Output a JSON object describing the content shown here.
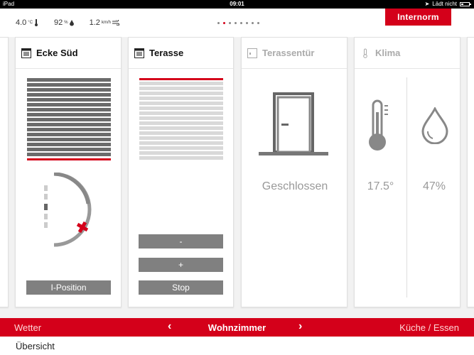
{
  "statusbar": {
    "device": "iPad",
    "time": "09:01",
    "charging": "Lädt nicht"
  },
  "weather": {
    "temperature": "4.0",
    "temp_unit": "°C",
    "humidity": "92",
    "hum_unit": "%",
    "wind": "1.2",
    "wind_unit": "km/h"
  },
  "brand": {
    "logo": "Internorm",
    "accent": "#d4001a"
  },
  "pager": {
    "count": 8,
    "active_index": 1
  },
  "cards": {
    "ecke_sued": {
      "title": "Ecke Süd",
      "button": "I-Position"
    },
    "terasse": {
      "title": "Terasse",
      "buttons": {
        "minus": "-",
        "plus": "+",
        "stop": "Stop"
      }
    },
    "terassentuer": {
      "title": "Terassentür",
      "status": "Geschlossen"
    },
    "klima": {
      "title": "Klima",
      "temperature": "17.5°",
      "humidity": "47%"
    }
  },
  "nav": {
    "left": "Wetter",
    "center": "Wohnzimmer",
    "right": "Küche / Essen",
    "prev_icon": "‹",
    "next_icon": "›"
  },
  "footer": {
    "overview": "Übersicht"
  }
}
